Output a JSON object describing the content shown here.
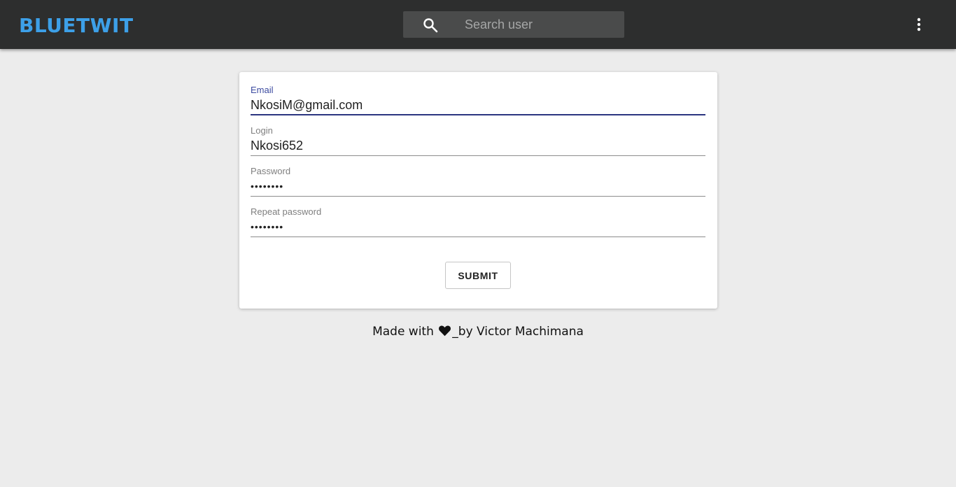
{
  "colors": {
    "appbar_bg": "#2d2e2e",
    "brand": "#3da0e8",
    "page_bg": "#ececec",
    "focus_accent": "#2b3580"
  },
  "header": {
    "brand": "BLUETWIT",
    "search": {
      "placeholder": "Search user",
      "value": "",
      "icon": "search-icon"
    },
    "menu_icon": "more-vert-icon"
  },
  "form": {
    "fields": [
      {
        "label": "Email",
        "value": "NkosiM@gmail.com",
        "type": "email",
        "focused": true
      },
      {
        "label": "Login",
        "value": "Nkosi652",
        "type": "text",
        "focused": false
      },
      {
        "label": "Password",
        "value": "xxxxxxxx",
        "type": "password",
        "focused": false
      },
      {
        "label": "Repeat password",
        "value": "xxxxxxxx",
        "type": "password",
        "focused": false
      }
    ],
    "submit_label": "SUBMIT"
  },
  "footer": {
    "before": "Made with",
    "heart_icon": "heart-icon",
    "after": "_by Victor Machimana"
  }
}
